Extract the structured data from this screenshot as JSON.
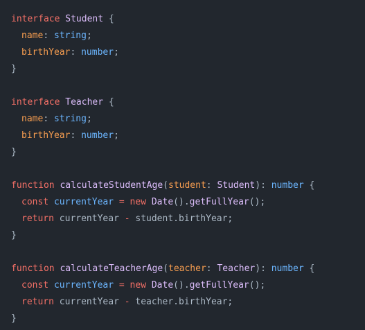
{
  "editor": {
    "colors": {
      "background": "#22272e",
      "keyword": "#f47067",
      "type_name": "#dcbdfb",
      "property": "#f69d50",
      "primitive_type": "#6cb6ff",
      "plain": "#adbac7"
    },
    "tokens": {
      "interface": "interface",
      "function": "function",
      "const": "const",
      "new": "new",
      "return": "return",
      "student_type": "Student",
      "teacher_type": "Teacher",
      "date_type": "Date",
      "name": "name",
      "birth_year": "birthYear",
      "string": "string",
      "number": "number",
      "fn_student": "calculateStudentAge",
      "fn_teacher": "calculateTeacherAge",
      "param_student": "student",
      "param_teacher": "teacher",
      "current_year": "currentYear",
      "get_full_year": "getFullYear",
      "open_brace": " {",
      "close_brace": "}",
      "colon": ": ",
      "semicolon": ";",
      "open_paren": "(",
      "close_paren_colon": "): ",
      "equals": " = ",
      "space": " ",
      "call_open": "().",
      "call_close": "();",
      "minus": " - ",
      "dot": ".",
      "student_dot_birth": "student.birthYear;",
      "teacher_dot_birth": "teacher.birthYear;"
    }
  }
}
